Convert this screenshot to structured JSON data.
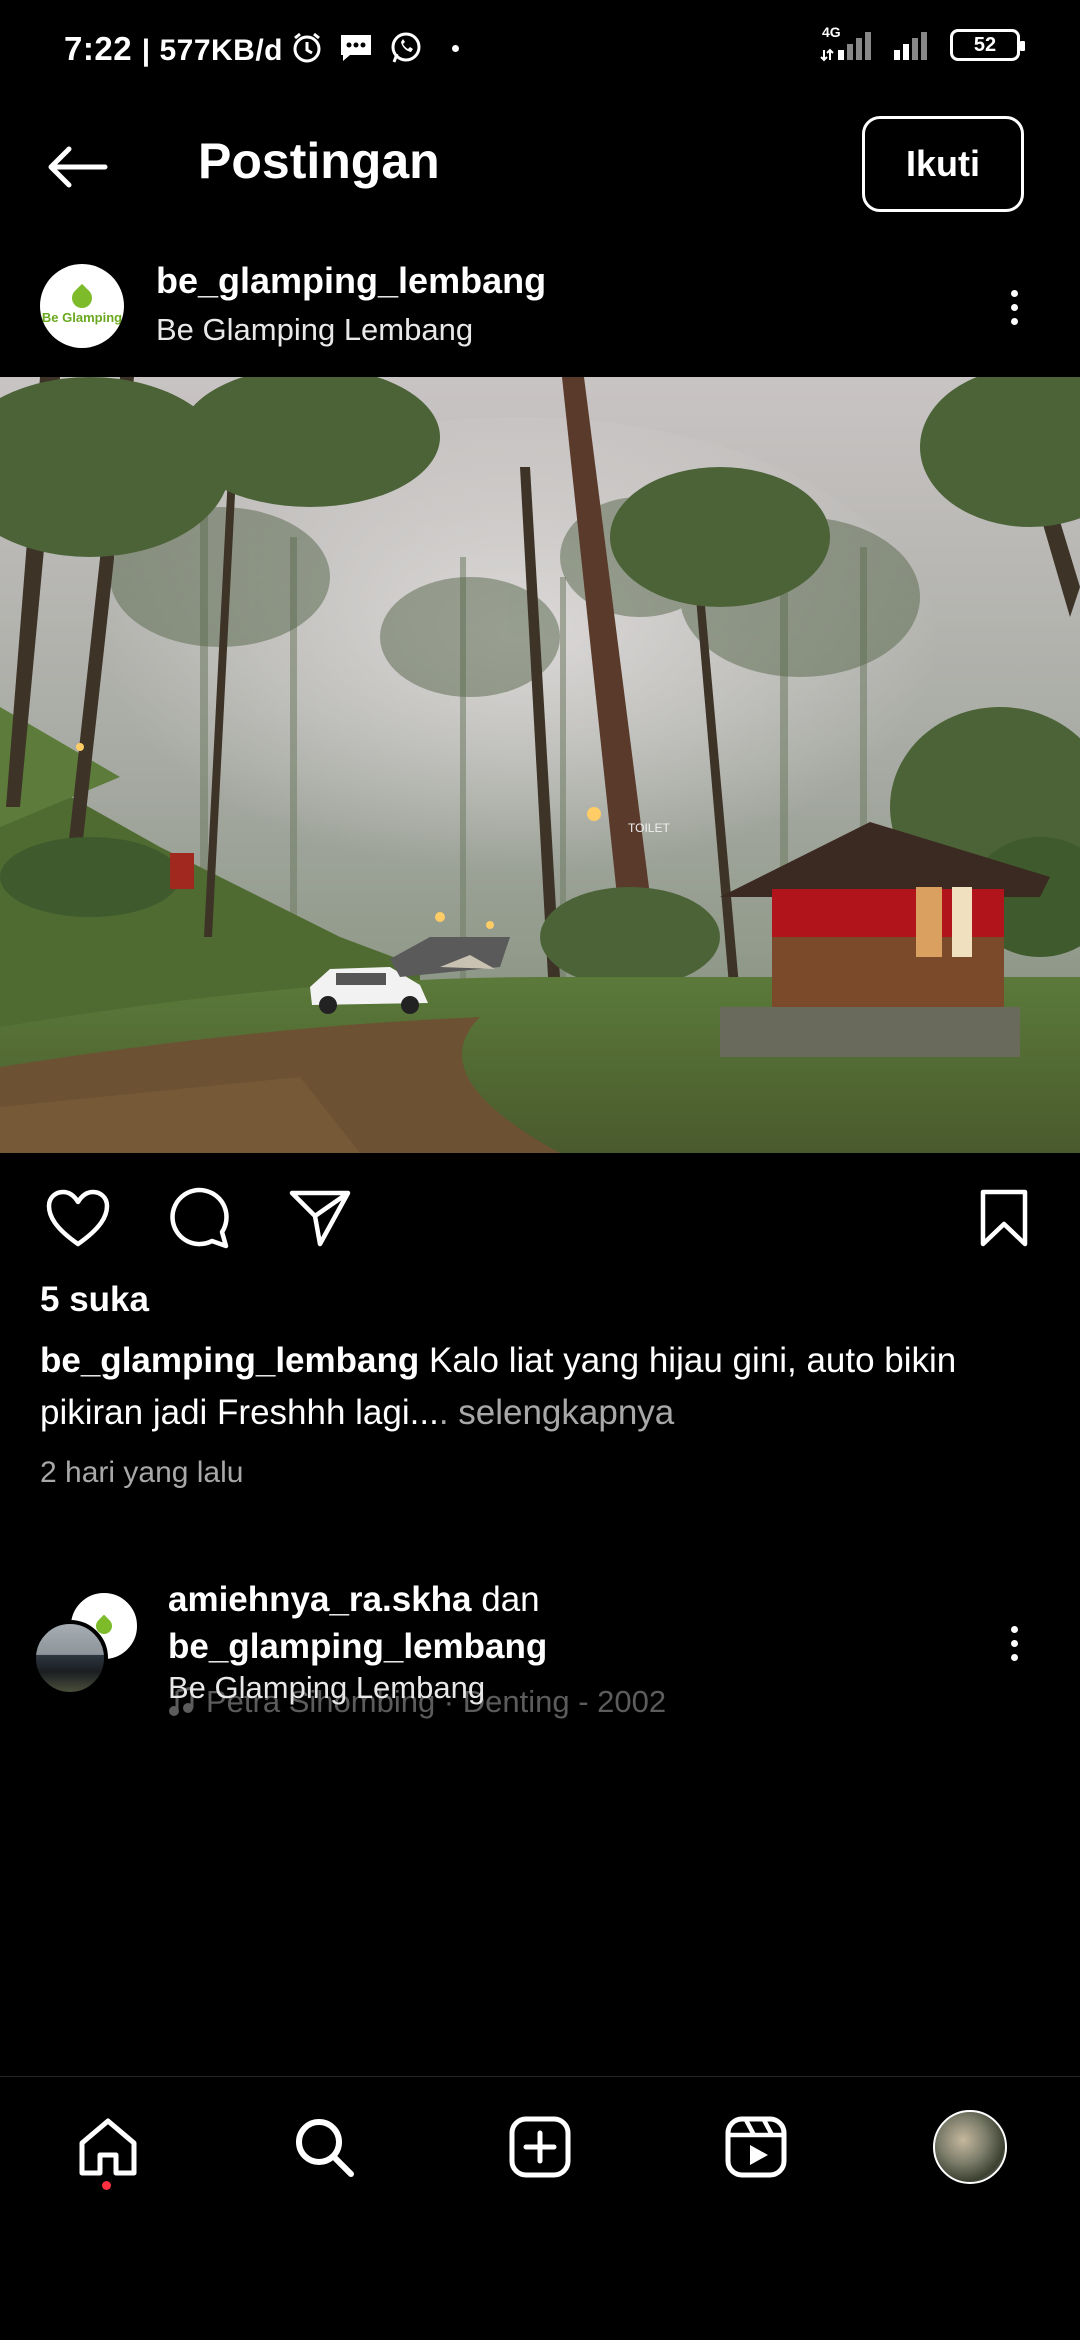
{
  "status_bar": {
    "time": "7:22",
    "speed": "| 577KB/d",
    "network": "4G",
    "battery": "52"
  },
  "header": {
    "title": "Postingan",
    "follow_label": "Ikuti"
  },
  "post": {
    "username": "be_glamping_lembang",
    "subtitle": "Be Glamping Lembang",
    "avatar_logo_text": "Be Glamping",
    "photo_sign": "TOILET",
    "likes": "5 suka",
    "caption_user": "be_glamping_lembang",
    "caption_text": " Kalo liat yang hijau gini, auto bikin pikiran jadi Freshhh lagi...",
    "caption_more": ". selengkapnya",
    "time_ago": "2 hari yang lalu"
  },
  "next_post": {
    "user1": "amiehnya_ra.skha",
    "connector": " dan",
    "user2": "be_glamping_lembang",
    "subtitle": "Be Glamping Lembang",
    "music": "Petra Sihombing · Denting - 2002"
  },
  "nav": {
    "items": [
      "home-icon",
      "search-icon",
      "create-icon",
      "reels-icon",
      "profile-avatar"
    ]
  },
  "colors": {
    "background": "#000000",
    "text": "#ffffff",
    "secondary_text": "#a8a8a8",
    "notification_dot": "#ff3040"
  }
}
